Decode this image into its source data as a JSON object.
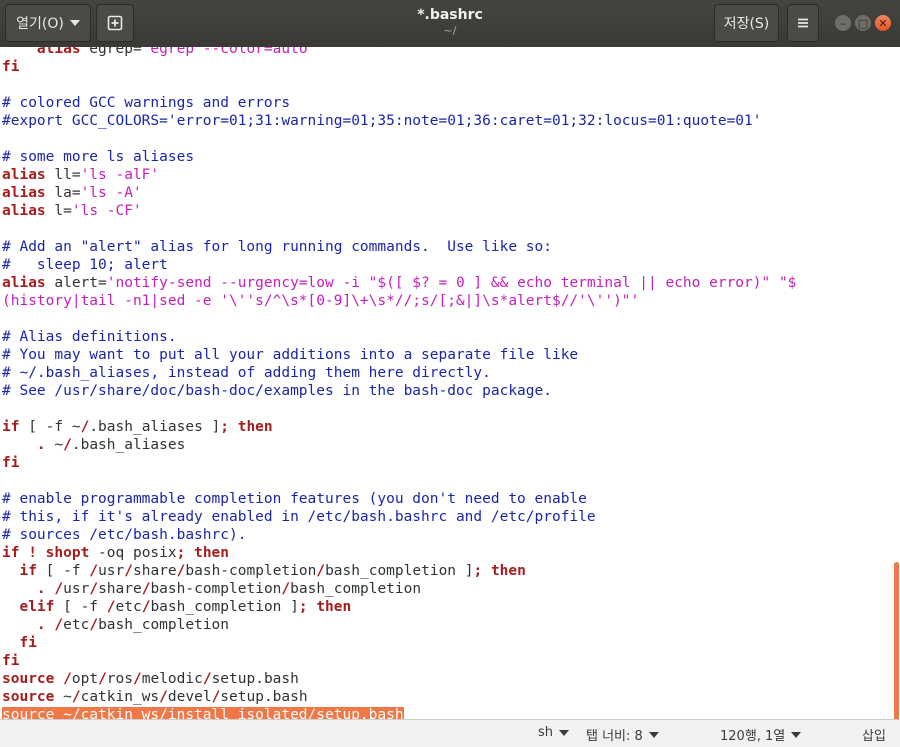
{
  "header": {
    "open_label": "열기(O)",
    "title": "*.bashrc",
    "subtitle": "~/",
    "save_label": "저장(S)"
  },
  "editor": {
    "lines": [
      [
        [
          "k",
          "    alias"
        ],
        [
          "n",
          " egrep="
        ],
        [
          "s",
          "'egrep --color=auto'"
        ]
      ],
      [
        [
          "k",
          "fi"
        ]
      ],
      [],
      [
        [
          "c",
          "# colored GCC warnings and errors"
        ]
      ],
      [
        [
          "c",
          "#export GCC_COLORS='error=01;31:warning=01;35:note=01;36:caret=01;32:locus=01:quote=01'"
        ]
      ],
      [],
      [
        [
          "c",
          "# some more ls aliases"
        ]
      ],
      [
        [
          "k",
          "alias"
        ],
        [
          "n",
          " ll="
        ],
        [
          "s",
          "'ls -alF'"
        ]
      ],
      [
        [
          "k",
          "alias"
        ],
        [
          "n",
          " la="
        ],
        [
          "s",
          "'ls -A'"
        ]
      ],
      [
        [
          "k",
          "alias"
        ],
        [
          "n",
          " l="
        ],
        [
          "s",
          "'ls -CF'"
        ]
      ],
      [],
      [
        [
          "c",
          "# Add an \"alert\" alias for long running commands.  Use like so:"
        ]
      ],
      [
        [
          "c",
          "#   sleep 10; alert"
        ]
      ],
      [
        [
          "k",
          "alias"
        ],
        [
          "n",
          " alert="
        ],
        [
          "s",
          "'notify-send --urgency=low -i \"$([ $? = 0 ] && echo terminal || echo error)\" \"$"
        ]
      ],
      [
        [
          "s",
          "(history|tail -n1|sed -e '\\''s/^\\s*[0-9]\\+\\s*//;s/[;&|]\\s*alert$//'\\'')\"'"
        ]
      ],
      [],
      [
        [
          "c",
          "# Alias definitions."
        ]
      ],
      [
        [
          "c",
          "# You may want to put all your additions into a separate file like"
        ]
      ],
      [
        [
          "c",
          "# ~/.bash_aliases, instead of adding them here directly."
        ]
      ],
      [
        [
          "c",
          "# See /usr/share/doc/bash-doc/examples in the bash-doc package."
        ]
      ],
      [],
      [
        [
          "k",
          "if"
        ],
        [
          "n",
          " [ -f ~"
        ],
        [
          "k",
          "/"
        ],
        [
          "n",
          ".bash_aliases ]"
        ],
        [
          "k",
          "; then"
        ]
      ],
      [
        [
          "n",
          "    "
        ],
        [
          "k",
          "."
        ],
        [
          "n",
          " ~"
        ],
        [
          "k",
          "/"
        ],
        [
          "n",
          ".bash_aliases"
        ]
      ],
      [
        [
          "k",
          "fi"
        ]
      ],
      [],
      [
        [
          "c",
          "# enable programmable completion features (you don't need to enable"
        ]
      ],
      [
        [
          "c",
          "# this, if it's already enabled in /etc/bash.bashrc and /etc/profile"
        ]
      ],
      [
        [
          "c",
          "# sources /etc/bash.bashrc)."
        ]
      ],
      [
        [
          "k",
          "if ! shopt"
        ],
        [
          "n",
          " -oq posix"
        ],
        [
          "k",
          "; then"
        ]
      ],
      [
        [
          "n",
          "  "
        ],
        [
          "k",
          "if"
        ],
        [
          "n",
          " [ -f "
        ],
        [
          "k",
          "/"
        ],
        [
          "n",
          "usr"
        ],
        [
          "k",
          "/"
        ],
        [
          "n",
          "share"
        ],
        [
          "k",
          "/"
        ],
        [
          "n",
          "bash-completion"
        ],
        [
          "k",
          "/"
        ],
        [
          "n",
          "bash_completion ]"
        ],
        [
          "k",
          "; then"
        ]
      ],
      [
        [
          "n",
          "    "
        ],
        [
          "k",
          "."
        ],
        [
          "n",
          " "
        ],
        [
          "k",
          "/"
        ],
        [
          "n",
          "usr"
        ],
        [
          "k",
          "/"
        ],
        [
          "n",
          "share"
        ],
        [
          "k",
          "/"
        ],
        [
          "n",
          "bash-completion"
        ],
        [
          "k",
          "/"
        ],
        [
          "n",
          "bash_completion"
        ]
      ],
      [
        [
          "n",
          "  "
        ],
        [
          "k",
          "elif"
        ],
        [
          "n",
          " [ -f "
        ],
        [
          "k",
          "/"
        ],
        [
          "n",
          "etc"
        ],
        [
          "k",
          "/"
        ],
        [
          "n",
          "bash_completion ]"
        ],
        [
          "k",
          "; then"
        ]
      ],
      [
        [
          "n",
          "    "
        ],
        [
          "k",
          "."
        ],
        [
          "n",
          " "
        ],
        [
          "k",
          "/"
        ],
        [
          "n",
          "etc"
        ],
        [
          "k",
          "/"
        ],
        [
          "n",
          "bash_completion"
        ]
      ],
      [
        [
          "n",
          "  "
        ],
        [
          "k",
          "fi"
        ]
      ],
      [
        [
          "k",
          "fi"
        ]
      ],
      [
        [
          "k",
          "source"
        ],
        [
          "n",
          " "
        ],
        [
          "k",
          "/"
        ],
        [
          "n",
          "opt"
        ],
        [
          "k",
          "/"
        ],
        [
          "n",
          "ros"
        ],
        [
          "k",
          "/"
        ],
        [
          "n",
          "melodic"
        ],
        [
          "k",
          "/"
        ],
        [
          "n",
          "setup.bash"
        ]
      ],
      [
        [
          "k",
          "source"
        ],
        [
          "n",
          " ~"
        ],
        [
          "k",
          "/"
        ],
        [
          "n",
          "catkin_ws"
        ],
        [
          "k",
          "/"
        ],
        [
          "n",
          "devel"
        ],
        [
          "k",
          "/"
        ],
        [
          "n",
          "setup.bash"
        ]
      ],
      [
        [
          "sel",
          "source ~/catkin_ws/install_isolated/setup.bash"
        ]
      ]
    ],
    "selected_line": 37
  },
  "statusbar": {
    "language": "sh",
    "tab_width": "탭 너비: 8",
    "position": "120행, 1열",
    "mode": "삽입"
  },
  "colors": {
    "comment": "#1a26a8",
    "keyword": "#a51d1d",
    "string": "#c41fb9",
    "selection": "#f07746"
  },
  "icons": {
    "new_tab": "new-tab-icon",
    "menu": "hamburger-menu-icon",
    "minimize": "minimize-icon",
    "maximize": "maximize-icon",
    "close": "close-icon"
  }
}
